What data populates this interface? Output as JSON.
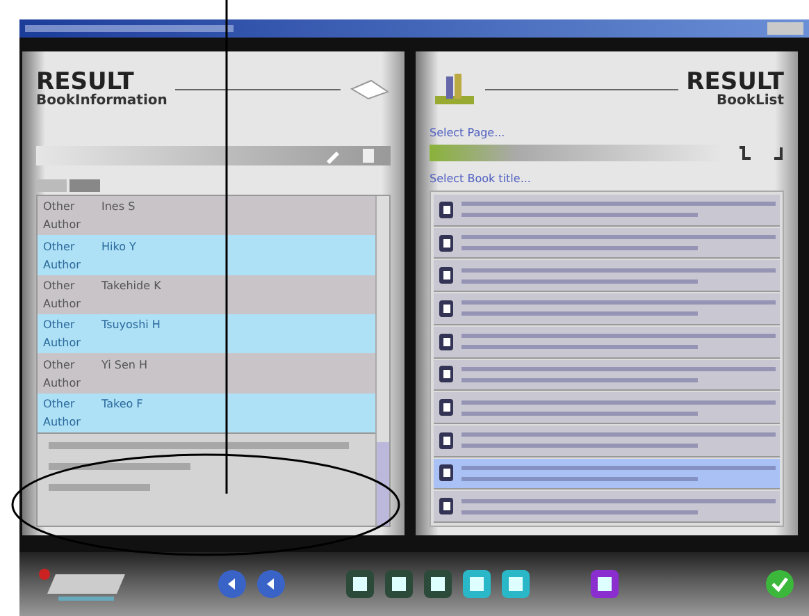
{
  "left_panel": {
    "title": "RESULT",
    "subtitle": "BookInformation",
    "people": [
      {
        "role": "Other",
        "name": "Ines S",
        "role_2": "Author"
      },
      {
        "role": "Other",
        "name": "Hiko Y",
        "role_2": "Author"
      },
      {
        "role": "Other",
        "name": "Takehide K",
        "role_2": "Author"
      },
      {
        "role": "Other",
        "name": "Tsuyoshi H",
        "role_2": "Author"
      },
      {
        "role": "Other",
        "name": "Yi Sen H",
        "role_2": "Author"
      },
      {
        "role": "Other",
        "name": "Takeo F",
        "role_2": "Author"
      }
    ]
  },
  "right_panel": {
    "title": "RESULT",
    "subtitle": "BookList",
    "page_label": "Select Page...",
    "list_label": "Select Book title...",
    "books": [
      {
        "selected": false
      },
      {
        "selected": false
      },
      {
        "selected": false
      },
      {
        "selected": false
      },
      {
        "selected": false
      },
      {
        "selected": false
      },
      {
        "selected": false
      },
      {
        "selected": false
      },
      {
        "selected": true
      },
      {
        "selected": false
      }
    ]
  }
}
